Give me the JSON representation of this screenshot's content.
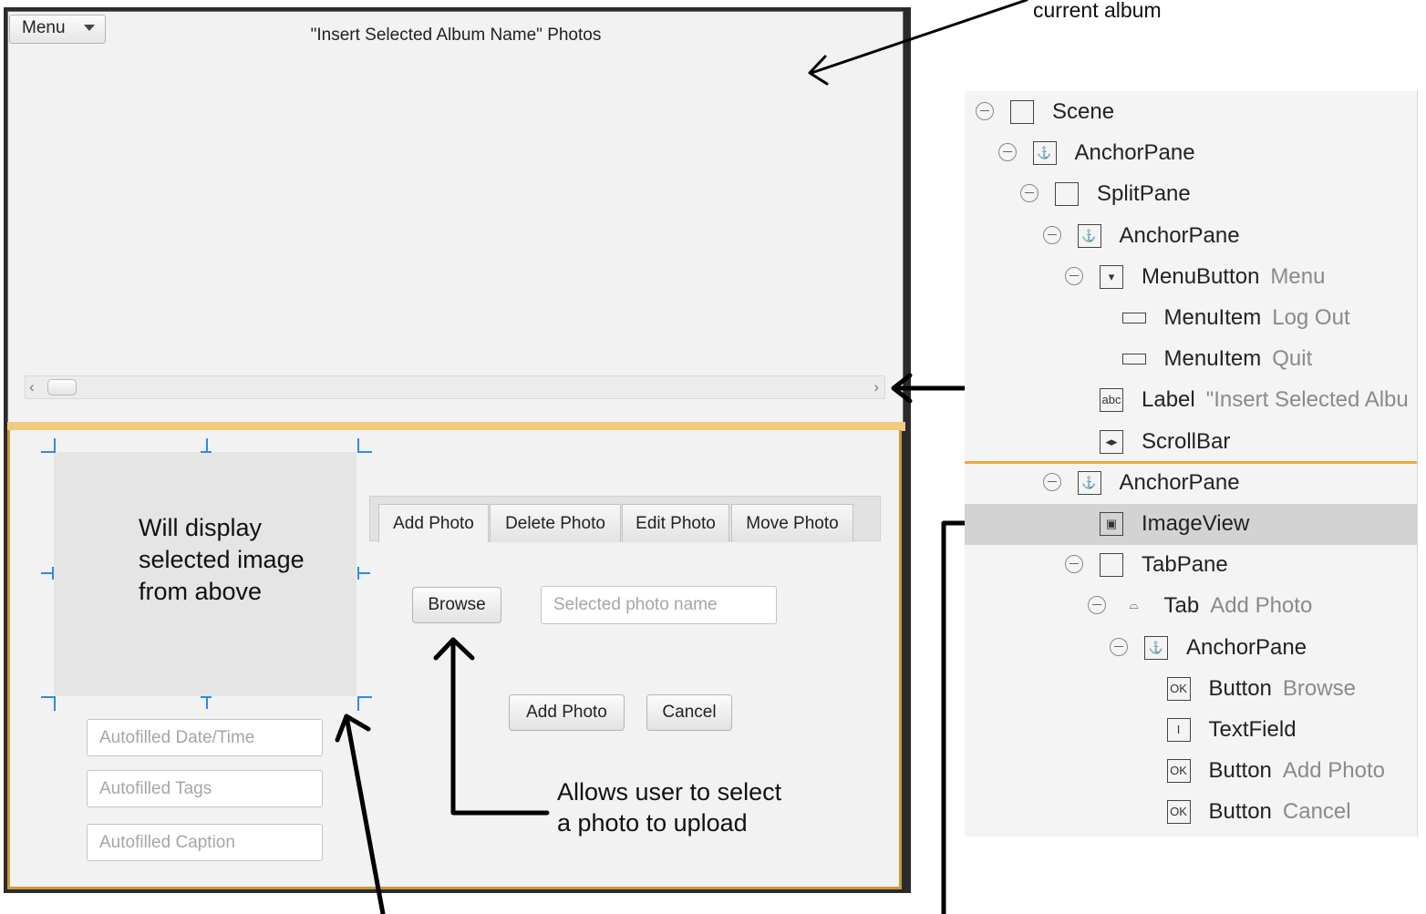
{
  "app": {
    "menu_button": "Menu",
    "album_label": "\"Insert Selected Album Name\" Photos",
    "image_placeholder": "Will display selected image from above",
    "tabs": [
      "Add Photo",
      "Delete Photo",
      "Edit Photo",
      "Move Photo"
    ],
    "browse_button": "Browse",
    "photo_name_placeholder": "Selected photo name",
    "add_photo_button": "Add Photo",
    "cancel_button": "Cancel",
    "date_placeholder": "Autofilled Date/Time",
    "tags_placeholder": "Autofilled Tags",
    "caption_placeholder": "Autofilled Caption"
  },
  "annotations": {
    "current_album": "current album",
    "browse_note_line1": "Allows user to select",
    "browse_note_line2": "a photo to upload"
  },
  "hierarchy": [
    {
      "type": "Scene",
      "value": "",
      "icon": "scene-icon"
    },
    {
      "type": "AnchorPane",
      "value": "",
      "icon": "anchor-icon"
    },
    {
      "type": "SplitPane",
      "value": "",
      "icon": "splitpane-icon"
    },
    {
      "type": "AnchorPane",
      "value": "",
      "icon": "anchor-icon"
    },
    {
      "type": "MenuButton",
      "value": "Menu",
      "icon": "menubutton-icon"
    },
    {
      "type": "MenuItem",
      "value": "Log Out",
      "icon": "menuitem-icon"
    },
    {
      "type": "MenuItem",
      "value": "Quit",
      "icon": "menuitem-icon"
    },
    {
      "type": "Label",
      "value": "\"Insert Selected Albu",
      "icon": "label-icon"
    },
    {
      "type": "ScrollBar",
      "value": "",
      "icon": "scrollbar-icon"
    },
    {
      "type": "AnchorPane",
      "value": "",
      "icon": "anchor-icon"
    },
    {
      "type": "ImageView",
      "value": "",
      "icon": "imageview-icon"
    },
    {
      "type": "TabPane",
      "value": "",
      "icon": "tabpane-icon"
    },
    {
      "type": "Tab",
      "value": "Add Photo",
      "icon": "tab-icon"
    },
    {
      "type": "AnchorPane",
      "value": "",
      "icon": "anchor-icon"
    },
    {
      "type": "Button",
      "value": "Browse",
      "icon": "button-ok-icon"
    },
    {
      "type": "TextField",
      "value": "",
      "icon": "textfield-icon"
    },
    {
      "type": "Button",
      "value": "Add Photo",
      "icon": "button-ok-icon"
    },
    {
      "type": "Button",
      "value": "Cancel",
      "icon": "button-ok-icon"
    }
  ],
  "colors": {
    "accent_orange": "#f0a73c",
    "selection_blue": "#2f8ae6"
  }
}
